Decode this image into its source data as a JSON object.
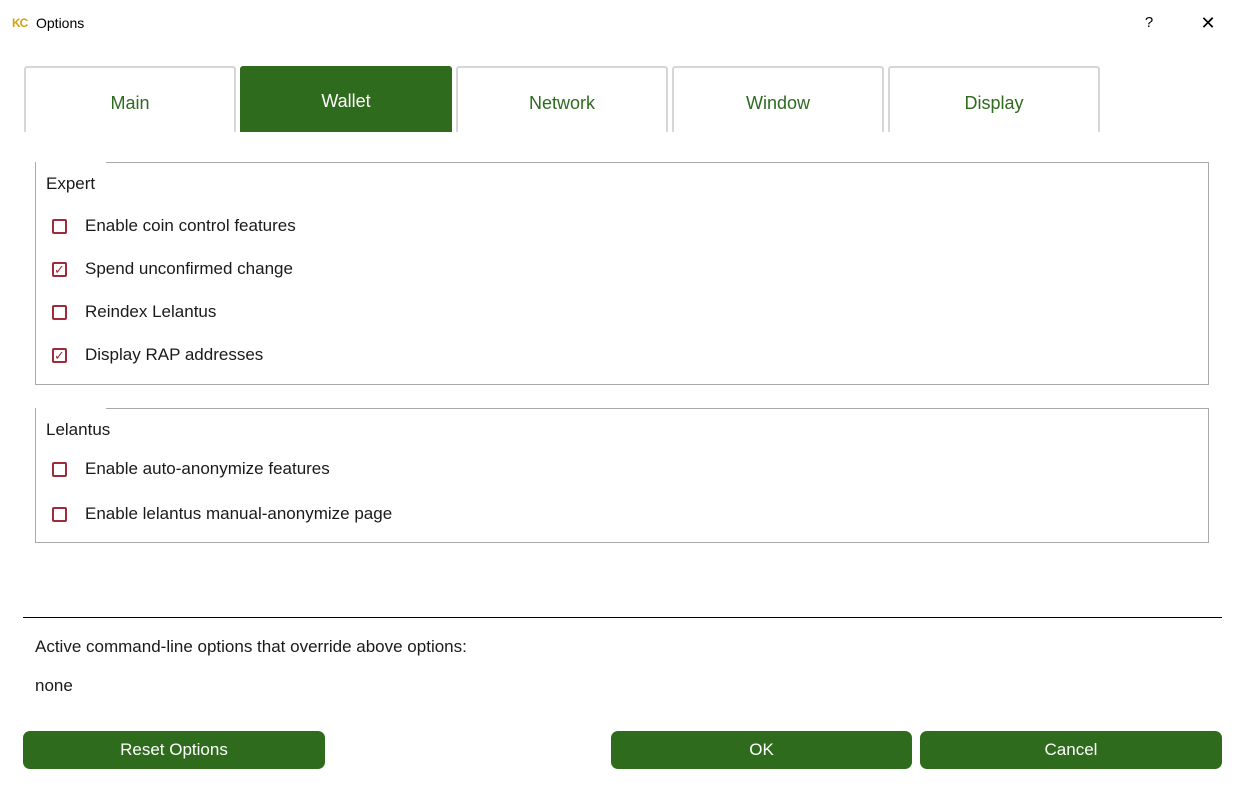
{
  "window": {
    "logo_text": "KC",
    "title": "Options",
    "help_label": "?",
    "close_label": "✕"
  },
  "tabs": [
    {
      "label": "Main",
      "active": false
    },
    {
      "label": "Wallet",
      "active": true
    },
    {
      "label": "Network",
      "active": false
    },
    {
      "label": "Window",
      "active": false
    },
    {
      "label": "Display",
      "active": false
    }
  ],
  "expert": {
    "title": "Expert",
    "items": [
      {
        "label": "Enable coin control features",
        "checked": false
      },
      {
        "label": "Spend unconfirmed change",
        "checked": true
      },
      {
        "label": "Reindex Lelantus",
        "checked": false
      },
      {
        "label": "Display RAP addresses",
        "checked": true
      }
    ]
  },
  "lelantus": {
    "title": "Lelantus",
    "items": [
      {
        "label": "Enable auto-anonymize features",
        "checked": false
      },
      {
        "label": "Enable lelantus manual-anonymize page",
        "checked": false
      }
    ]
  },
  "command_line": {
    "label": "Active command-line options that override above options:",
    "value": "none"
  },
  "buttons": {
    "reset": "Reset Options",
    "ok": "OK",
    "cancel": "Cancel"
  },
  "colors": {
    "accent_green": "#2f6b1d",
    "checkbox_red": "#a02a3a"
  }
}
